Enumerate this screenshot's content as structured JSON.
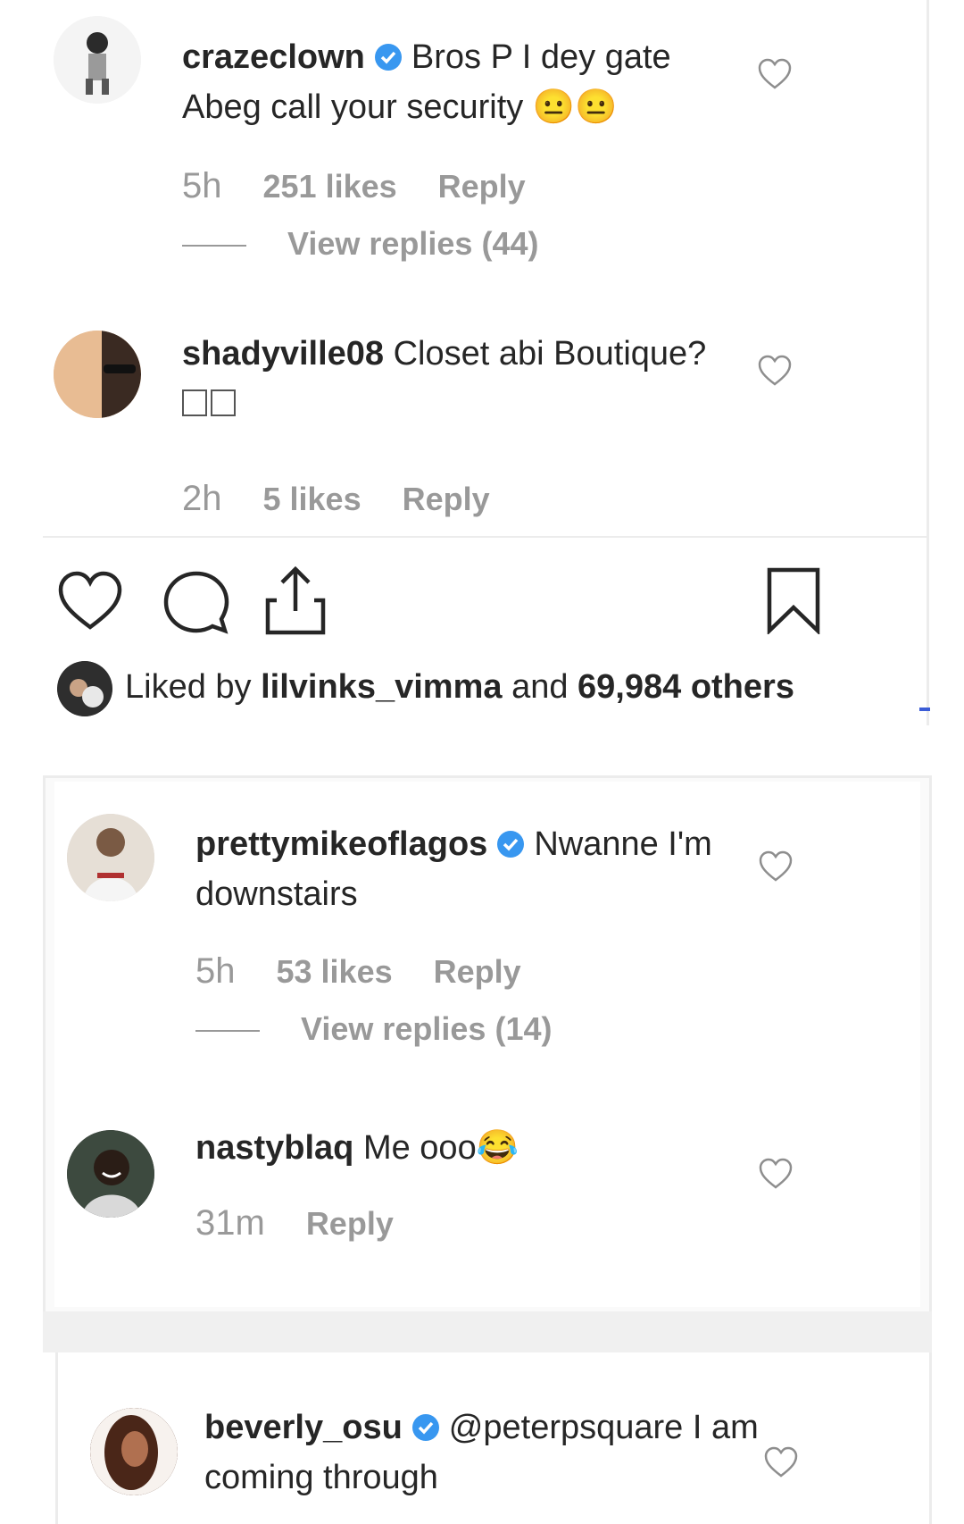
{
  "colors": {
    "verified": "#3897f0",
    "muted": "#999999",
    "text": "#262626"
  },
  "comments_top": [
    {
      "username": "crazeclown",
      "verified": true,
      "text": "Bros P I dey gate Abeg call your security 😐😐",
      "time": "5h",
      "likes": "251 likes",
      "reply": "Reply",
      "view_replies": "View replies (44)"
    },
    {
      "username": "shadyville08",
      "verified": false,
      "text": "Closet abi Boutique?",
      "time": "2h",
      "likes": "5 likes",
      "reply": "Reply"
    }
  ],
  "post_actions": {
    "icons": [
      "heart-icon",
      "comment-icon",
      "share-icon",
      "bookmark-icon"
    ],
    "liked_by_prefix": "Liked by",
    "liked_by_user": "lilvinks_vimma",
    "liked_by_and": "and",
    "liked_by_others": "69,984 others"
  },
  "comments_mid": [
    {
      "username": "prettymikeoflagos",
      "verified": true,
      "text": "Nwanne I'm downstairs",
      "time": "5h",
      "likes": "53 likes",
      "reply": "Reply",
      "view_replies": "View replies (14)"
    },
    {
      "username": "nastyblaq",
      "verified": false,
      "text": "Me ooo😂",
      "time": "31m",
      "reply": "Reply"
    }
  ],
  "comments_bottom": [
    {
      "username": "beverly_osu",
      "verified": true,
      "text": "@peterpsquare I am coming through"
    }
  ]
}
